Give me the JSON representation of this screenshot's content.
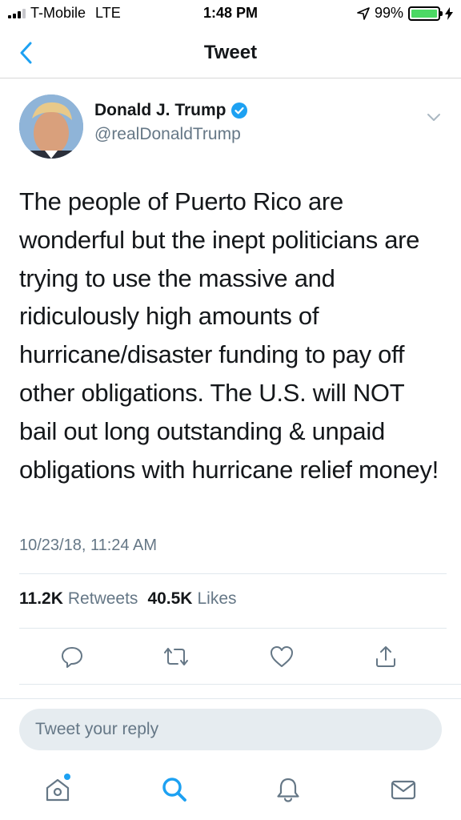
{
  "status_bar": {
    "carrier": "T-Mobile",
    "network": "LTE",
    "time": "1:48 PM",
    "battery": "99%",
    "battery_level": 0.99,
    "icons": [
      "signal-icon",
      "location-arrow-icon",
      "battery-icon",
      "charging-bolt-icon"
    ]
  },
  "nav": {
    "title": "Tweet",
    "back_icon": "chevron-left-icon"
  },
  "tweet": {
    "author": {
      "display_name": "Donald J. Trump",
      "handle": "@realDonaldTrump",
      "verified": true
    },
    "text": "The people of Puerto Rico are wonderful but the inept politicians are trying to use the massive and ridiculously high amounts of hurricane/disaster funding to pay off other obligations. The U.S. will NOT bail out long outstanding & unpaid obligations with hurricane relief money!",
    "timestamp": "10/23/18, 11:24 AM",
    "stats": {
      "retweets_count": "11.2K",
      "retweets_label": "Retweets",
      "likes_count": "40.5K",
      "likes_label": "Likes"
    },
    "actions": [
      "reply-icon",
      "retweet-icon",
      "like-icon",
      "share-icon"
    ]
  },
  "reply": {
    "placeholder": "Tweet your reply"
  },
  "tab_bar": {
    "tabs": [
      "home-icon",
      "search-icon",
      "notifications-icon",
      "messages-icon"
    ],
    "home_has_new": true
  },
  "colors": {
    "accent": "#1da1f2",
    "text": "#14171a",
    "secondary": "#657786",
    "icon": "#657786",
    "divider": "#e1e8ed",
    "battery": "#4cd964"
  }
}
